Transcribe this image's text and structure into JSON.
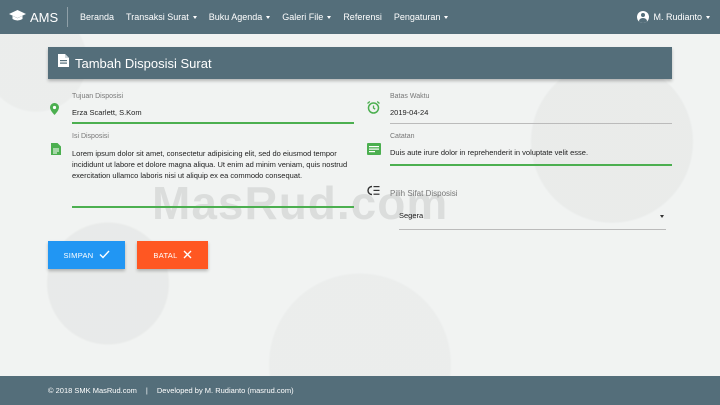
{
  "navbar": {
    "brand": "AMS",
    "items": [
      {
        "label": "Beranda",
        "dropdown": false
      },
      {
        "label": "Transaksi Surat",
        "dropdown": true
      },
      {
        "label": "Buku Agenda",
        "dropdown": true
      },
      {
        "label": "Galeri File",
        "dropdown": true
      },
      {
        "label": "Referensi",
        "dropdown": false
      },
      {
        "label": "Pengaturan",
        "dropdown": true
      }
    ],
    "user": "M. Rudianto"
  },
  "card": {
    "title": "Tambah Disposisi Surat"
  },
  "form": {
    "tujuan": {
      "label": "Tujuan Disposisi",
      "value": "Erza Scarlett, S.Kom"
    },
    "batas": {
      "label": "Batas Waktu",
      "value": "2019-04-24"
    },
    "isi": {
      "label": "Isi Disposisi",
      "value": "Lorem ipsum dolor sit amet, consectetur adipisicing elit, sed do eiusmod tempor incididunt ut labore et dolore magna aliqua. Ut enim ad minim veniam, quis nostrud exercitation ullamco laboris nisi ut aliquip ex ea commodo consequat."
    },
    "catatan": {
      "label": "Catatan",
      "value": "Duis aute irure dolor in reprehenderit in voluptate velit esse."
    },
    "sifat": {
      "label": "Pilih Sifat Disposisi",
      "value": "Segera"
    }
  },
  "buttons": {
    "save": "SIMPAN",
    "cancel": "BATAL"
  },
  "watermark": "MasRud.com",
  "footer": {
    "copyright": "© 2018 SMK MasRud.com",
    "separator": "|",
    "developer": "Developed by M. Rudianto (masrud.com)"
  },
  "colors": {
    "primary": "#546e7a",
    "accent_green": "#4caf50",
    "save_blue": "#2196f3",
    "cancel_orange": "#ff5722"
  },
  "icons": {
    "brand": "graduation-cap-icon",
    "tujuan": "location-pin-icon",
    "batas": "alarm-clock-icon",
    "isi": "document-icon",
    "catatan": "note-icon",
    "sifat": "format-list-icon"
  }
}
